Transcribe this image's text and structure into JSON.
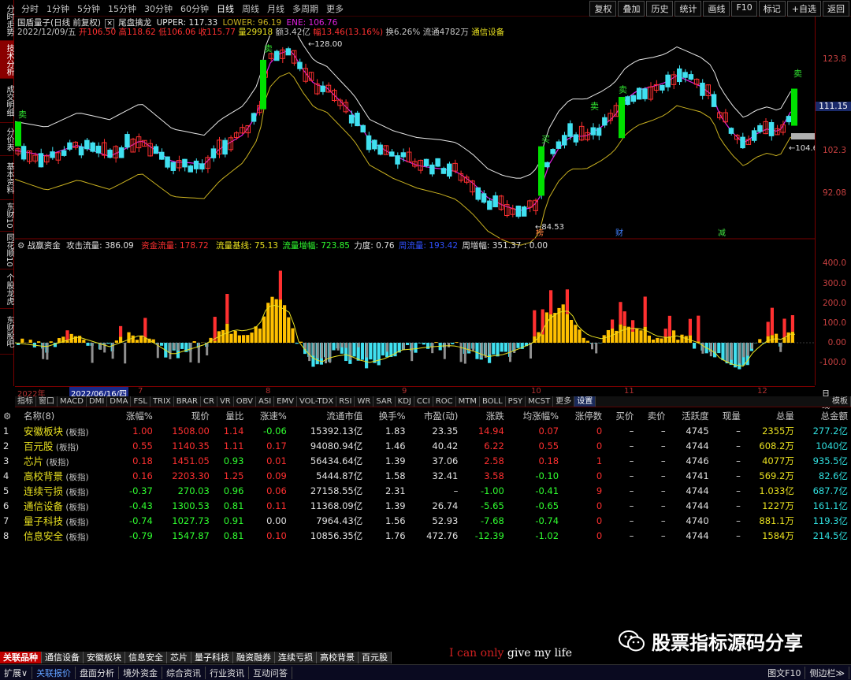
{
  "period_tabs": [
    "分时",
    "1分钟",
    "5分钟",
    "15分钟",
    "30分钟",
    "60分钟",
    "日线",
    "周线",
    "月线",
    "多周期",
    "更多"
  ],
  "active_period": "日线",
  "toolbar_buttons": [
    "复权",
    "叠加",
    "历史",
    "统计",
    "画线",
    "F10",
    "标记",
    "+自选",
    "返回"
  ],
  "left_tabs": [
    "分时走势",
    "技术分析",
    "成交明细",
    "分价表",
    "基本资料",
    "东财10",
    "同花顺10",
    "个股龙虎",
    "东财股吧"
  ],
  "info_line1": {
    "name": "国盾量子(日线 前复权)",
    "indicator": "尾盘擒龙",
    "upper_label": "UPPER: 117.33",
    "lower_label": "LOWER: 96.19",
    "ene_label": "ENE: 106.76"
  },
  "info_line2": {
    "date": "2022/12/09/五",
    "open": "开106.50",
    "high": "高118.62",
    "low": "低106.06",
    "close": "收115.77",
    "volume": "量29918",
    "amount": "额3.42亿",
    "change": "幅13.46(13.16%)",
    "turnover": "换6.26%",
    "float": "流通4782万",
    "sector": "通信设备"
  },
  "chart_annotations": {
    "high_mark": "128.00",
    "low_mark": "84.53",
    "last_price_tag": "104.63",
    "current_price_box": "111.15",
    "sell_label": "卖",
    "buy_label": "买",
    "bottom_markers": [
      "榜",
      "财",
      "减"
    ]
  },
  "price_axis": [
    "123.8",
    "113.0",
    "102.3",
    "92.08"
  ],
  "indicator_axis": [
    "400.0",
    "300.0",
    "200.0",
    "100.0",
    "0.00",
    "-100.0"
  ],
  "indicator_header": {
    "name": "战赢资金",
    "attack": "攻击流量: 386.09",
    "fund": "资金流量: 178.72",
    "base": "流量基线: 75.13",
    "increase": "流量增幅: 723.85",
    "strength": "力度: 0.76",
    "week_flow": "周流量: 193.42",
    "week_inc": "周增幅: 351.37",
    "last": ": 0.00"
  },
  "date_axis": {
    "year": "2022年",
    "cursor_date": "2022/06/16/四",
    "months": [
      "7",
      "8",
      "9",
      "10",
      "11",
      "12"
    ],
    "right_label": "日线"
  },
  "indicator_tabs": [
    "指标",
    "窗口",
    "MACD",
    "DMI",
    "DMA",
    "FSL",
    "TRIX",
    "BRAR",
    "CR",
    "VR",
    "OBV",
    "ASI",
    "EMV",
    "VOL-TDX",
    "RSI",
    "WR",
    "SAR",
    "KDJ",
    "CCI",
    "ROC",
    "MTM",
    "BOLL",
    "PSY",
    "MCST",
    "更多",
    "设置"
  ],
  "indicator_tab_right": "模板",
  "table": {
    "headers": [
      "",
      "名称(8)",
      "涨幅%",
      "现价",
      "量比",
      "涨速%",
      "流通市值",
      "换手%",
      "市盈(动)",
      "涨跌",
      "均涨幅%",
      "涨停数",
      "买价",
      "卖价",
      "活跃度",
      "现量",
      "总量",
      "总金额"
    ],
    "rows": [
      {
        "idx": "1",
        "name": "安徽板块",
        "tag": "(板指)",
        "chg": "1.00",
        "price": "1508.00",
        "vr": "1.14",
        "spd": "-0.06",
        "mcap": "15392.13亿",
        "turn": "1.83",
        "pe": "23.35",
        "diff": "14.94",
        "avg": "0.07",
        "lim": "0",
        "bid": "–",
        "ask": "–",
        "act": "4745",
        "cur": "–",
        "vol": "2355万",
        "amt": "277.2亿"
      },
      {
        "idx": "2",
        "name": "百元股",
        "tag": "(板指)",
        "chg": "0.55",
        "price": "1140.35",
        "vr": "1.11",
        "spd": "0.17",
        "mcap": "94080.94亿",
        "turn": "1.46",
        "pe": "40.42",
        "diff": "6.22",
        "avg": "0.55",
        "lim": "0",
        "bid": "–",
        "ask": "–",
        "act": "4744",
        "cur": "–",
        "vol": "608.2万",
        "amt": "1040亿"
      },
      {
        "idx": "3",
        "name": "芯片",
        "tag": "(板指)",
        "chg": "0.18",
        "price": "1451.05",
        "vr": "0.93",
        "spd": "0.01",
        "mcap": "56434.64亿",
        "turn": "1.39",
        "pe": "37.06",
        "diff": "2.58",
        "avg": "0.18",
        "lim": "1",
        "bid": "–",
        "ask": "–",
        "act": "4746",
        "cur": "–",
        "vol": "4077万",
        "amt": "935.5亿"
      },
      {
        "idx": "4",
        "name": "高校背景",
        "tag": "(板指)",
        "chg": "0.16",
        "price": "2203.30",
        "vr": "1.25",
        "spd": "0.09",
        "mcap": "5444.87亿",
        "turn": "1.58",
        "pe": "32.41",
        "diff": "3.58",
        "avg": "-0.10",
        "lim": "0",
        "bid": "–",
        "ask": "–",
        "act": "4741",
        "cur": "–",
        "vol": "569.2万",
        "amt": "82.6亿"
      },
      {
        "idx": "5",
        "name": "连续亏损",
        "tag": "(板指)",
        "chg": "-0.37",
        "price": "270.03",
        "vr": "0.96",
        "spd": "0.06",
        "mcap": "27158.55亿",
        "turn": "2.31",
        "pe": "–",
        "diff": "-1.00",
        "avg": "-0.41",
        "lim": "9",
        "bid": "–",
        "ask": "–",
        "act": "4744",
        "cur": "–",
        "vol": "1.033亿",
        "amt": "687.7亿"
      },
      {
        "idx": "6",
        "name": "通信设备",
        "tag": "(板指)",
        "chg": "-0.43",
        "price": "1300.53",
        "vr": "0.81",
        "spd": "0.11",
        "mcap": "11368.09亿",
        "turn": "1.39",
        "pe": "26.74",
        "diff": "-5.65",
        "avg": "-0.65",
        "lim": "0",
        "bid": "–",
        "ask": "–",
        "act": "4744",
        "cur": "–",
        "vol": "1227万",
        "amt": "161.1亿"
      },
      {
        "idx": "7",
        "name": "量子科技",
        "tag": "(板指)",
        "chg": "-0.74",
        "price": "1027.73",
        "vr": "0.91",
        "spd": "0.00",
        "mcap": "7964.43亿",
        "turn": "1.56",
        "pe": "52.93",
        "diff": "-7.68",
        "avg": "-0.74",
        "lim": "0",
        "bid": "–",
        "ask": "–",
        "act": "4740",
        "cur": "–",
        "vol": "881.1万",
        "amt": "119.3亿"
      },
      {
        "idx": "8",
        "name": "信息安全",
        "tag": "(板指)",
        "chg": "-0.79",
        "price": "1547.87",
        "vr": "0.81",
        "spd": "0.10",
        "mcap": "10856.35亿",
        "turn": "1.76",
        "pe": "472.76",
        "diff": "-12.39",
        "avg": "-1.02",
        "lim": "0",
        "bid": "–",
        "ask": "–",
        "act": "4744",
        "cur": "–",
        "vol": "1584万",
        "amt": "214.5亿"
      }
    ]
  },
  "sector_tabs": [
    "关联品种",
    "通信设备",
    "安徽板块",
    "信息安全",
    "芯片",
    "量子科技",
    "融资融券",
    "连续亏损",
    "高校背景",
    "百元股"
  ],
  "status_buttons": [
    "扩展∨",
    "关联报价",
    "盘面分析",
    "境外资金",
    "综合资讯",
    "行业资讯",
    "互动问答"
  ],
  "status_right": [
    "图文F10",
    "侧边栏≫"
  ],
  "watermark_text": "股票指标源码分享",
  "motto": {
    "red": "I can only",
    "white": " give my life"
  },
  "colors": {
    "up": "#ff3030",
    "down": "#30ff30",
    "upper_band": "#e8e8e8",
    "lower_band": "#c8b020",
    "ma": "#e020e0",
    "buy_bar": "#00e000",
    "cyan": "#40e0f0",
    "yellow": "#ffc000",
    "grey": "#909090"
  }
}
